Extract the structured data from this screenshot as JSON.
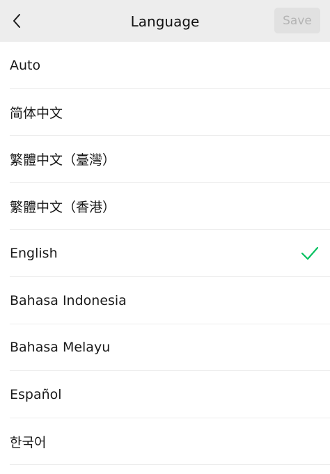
{
  "header": {
    "title": "Language",
    "save_label": "Save"
  },
  "languages": [
    {
      "label": "Auto",
      "selected": false
    },
    {
      "label": "简体中文",
      "selected": false
    },
    {
      "label": "繁體中文（臺灣）",
      "selected": false
    },
    {
      "label": "繁體中文（香港）",
      "selected": false
    },
    {
      "label": "English",
      "selected": true
    },
    {
      "label": "Bahasa Indonesia",
      "selected": false
    },
    {
      "label": "Bahasa Melayu",
      "selected": false
    },
    {
      "label": "Español",
      "selected": false
    },
    {
      "label": "한국어",
      "selected": false
    }
  ],
  "icons": {
    "back": "chevron-left-icon",
    "selected": "check-icon"
  },
  "colors": {
    "header_bg": "#ededed",
    "check": "#07c160",
    "save_bg": "#e1e1e1",
    "save_text": "#b4b4b4"
  }
}
